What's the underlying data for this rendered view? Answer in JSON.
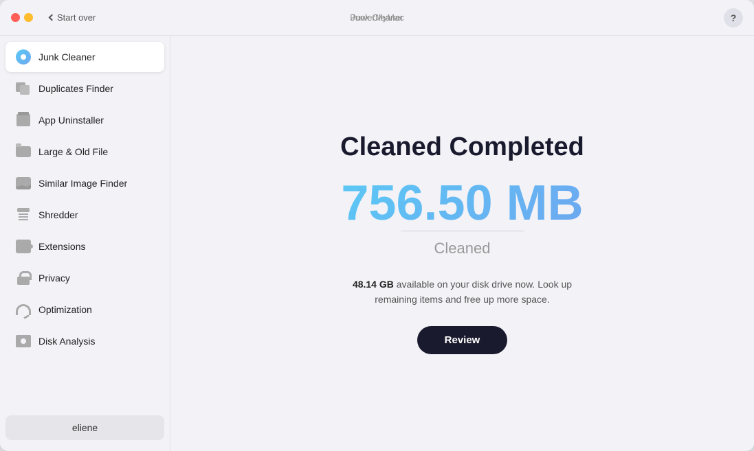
{
  "window": {
    "app_name": "PowerMyMac",
    "title": "Junk Cleaner",
    "start_over_label": "Start over",
    "help_label": "?"
  },
  "sidebar": {
    "items": [
      {
        "id": "junk-cleaner",
        "label": "Junk Cleaner",
        "active": true
      },
      {
        "id": "duplicates-finder",
        "label": "Duplicates Finder",
        "active": false
      },
      {
        "id": "app-uninstaller",
        "label": "App Uninstaller",
        "active": false
      },
      {
        "id": "large-old-file",
        "label": "Large & Old File",
        "active": false
      },
      {
        "id": "similar-image-finder",
        "label": "Similar Image Finder",
        "active": false
      },
      {
        "id": "shredder",
        "label": "Shredder",
        "active": false
      },
      {
        "id": "extensions",
        "label": "Extensions",
        "active": false
      },
      {
        "id": "privacy",
        "label": "Privacy",
        "active": false
      },
      {
        "id": "optimization",
        "label": "Optimization",
        "active": false
      },
      {
        "id": "disk-analysis",
        "label": "Disk Analysis",
        "active": false
      }
    ],
    "user": "eliene"
  },
  "main": {
    "cleaned_title": "Cleaned Completed",
    "cleaned_size": "756.50 MB",
    "cleaned_label": "Cleaned",
    "disk_gb": "48.14 GB",
    "disk_info_suffix": " available on your disk drive now. Look up remaining items and free up more space.",
    "review_button": "Review"
  }
}
